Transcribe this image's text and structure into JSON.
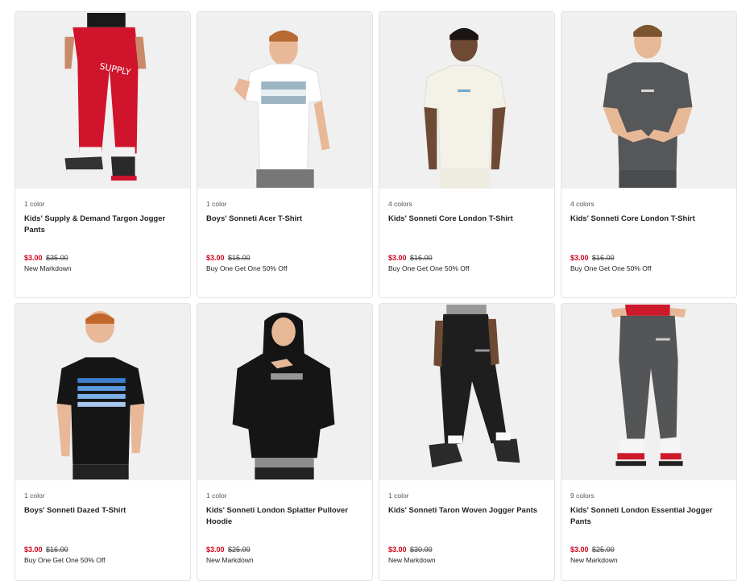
{
  "products": [
    {
      "colors": "1 color",
      "title": "Kids' Supply & Demand Targon Jogger Pants",
      "sale_price": "$3.00",
      "original_price": "$35.00",
      "promo": "New Markdown"
    },
    {
      "colors": "1 color",
      "title": "Boys' Sonneti Acer T-Shirt",
      "sale_price": "$3.00",
      "original_price": "$15.00",
      "promo": "Buy One Get One 50% Off"
    },
    {
      "colors": "4 colors",
      "title": "Kids' Sonneti Core London T-Shirt",
      "sale_price": "$3.00",
      "original_price": "$16.00",
      "promo": "Buy One Get One 50% Off"
    },
    {
      "colors": "4 colors",
      "title": "Kids' Sonneti Core London T-Shirt",
      "sale_price": "$3.00",
      "original_price": "$16.00",
      "promo": "Buy One Get One 50% Off"
    },
    {
      "colors": "1 color",
      "title": "Boys' Sonneti Dazed T-Shirt",
      "sale_price": "$3.00",
      "original_price": "$16.00",
      "promo": "Buy One Get One 50% Off"
    },
    {
      "colors": "1 color",
      "title": "Kids' Sonneti London Splatter Pullover Hoodie",
      "sale_price": "$3.00",
      "original_price": "$25.00",
      "promo": "New Markdown"
    },
    {
      "colors": "1 color",
      "title": "Kids' Sonneti Taron Woven Jogger Pants",
      "sale_price": "$3.00",
      "original_price": "$30.00",
      "promo": "New Markdown"
    },
    {
      "colors": "9 colors",
      "title": "Kids' Sonneti London Essential Jogger Pants",
      "sale_price": "$3.00",
      "original_price": "$25.00",
      "promo": "New Markdown"
    }
  ],
  "colors": {
    "sale": "#d0021b",
    "image_bg": "#f0f0f0",
    "border": "#e3e3e3"
  }
}
